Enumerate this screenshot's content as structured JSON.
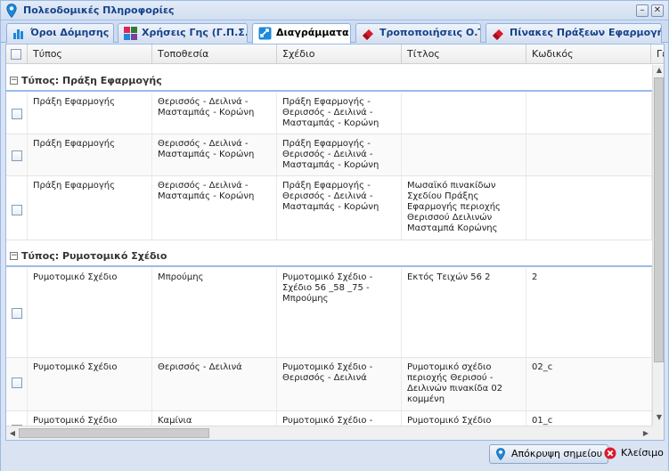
{
  "window": {
    "title": "Πολεοδομικές Πληροφορίες"
  },
  "tabs": [
    {
      "label": "Όροι Δόμησης",
      "icon": "bar-chart-icon"
    },
    {
      "label": "Χρήσεις Γης (Γ.Π.Σ.)",
      "icon": "color-squares-icon"
    },
    {
      "label": "Διαγράμματα",
      "icon": "diagram-icon",
      "active": true
    },
    {
      "label": "Τροποποιήσεις Ο.Τ.",
      "icon": "eraser-icon"
    },
    {
      "label": "Πίνακες Πράξεων Εφαρμογής",
      "icon": "eraser-icon"
    }
  ],
  "columns": [
    "Τύπος",
    "Τοποθεσία",
    "Σχέδιο",
    "Τίτλος",
    "Κωδικός",
    "Γε"
  ],
  "groups": [
    {
      "label": "Τύπος: Πράξη Εφαρμογής",
      "rows": [
        {
          "type": "Πράξη Εφαρμογής",
          "location": "Θερισσός - Δειλινά - Μασταμπάς - Κορώνη",
          "plan": "Πράξη Εφαρμογής - Θερισσός - Δειλινά - Μασταμπάς - Κορώνη",
          "title": "",
          "code": ""
        },
        {
          "type": "Πράξη Εφαρμογής",
          "location": "Θερισσός - Δειλινά - Μασταμπάς - Κορώνη",
          "plan": "Πράξη Εφαρμογής - Θερισσός - Δειλινά - Μασταμπάς - Κορώνη",
          "title": "",
          "code": ""
        },
        {
          "type": "Πράξη Εφαρμογής",
          "location": "Θερισσός - Δειλινά - Μασταμπάς - Κορώνη",
          "plan": "Πράξη Εφαρμογής - Θερισσός - Δειλινά - Μασταμπάς - Κορώνη",
          "title": "Μωσαϊκό πινακίδων Σχεδίου Πράξης Εφαρμογής περιοχής Θερισσού Δειλινών Μασταμπά Κορώνης",
          "code": ""
        }
      ]
    },
    {
      "label": "Τύπος: Ρυμοτομικό Σχέδιο",
      "rows": [
        {
          "type": "Ρυμοτομικό Σχέδιο",
          "location": "Μπρούμης",
          "plan": "Ρυμοτομικό Σχέδιο - Σχέδιο 56 _58 _75 - Μπρούμης",
          "title": "Εκτός Τειχών 56 2",
          "code": "2"
        },
        {
          "type": "Ρυμοτομικό Σχέδιο",
          "location": "Θερισσός - Δειλινά",
          "plan": "Ρυμοτομικό Σχέδιο - Θερισσός - Δειλινά",
          "title": "Ρυμοτομικό σχέδιο περιοχής Θερισού - Δειλινών πινακίδα 02 κομμένη",
          "code": "02_c"
        },
        {
          "type": "Ρυμοτομικό Σχέδιο",
          "location": "Καμίνια",
          "plan": "Ρυμοτομικό Σχέδιο -",
          "title": "Ρυμοτομικό Σχέδιο",
          "code": "01_c"
        }
      ]
    }
  ],
  "footer": {
    "hide_point_label": "Απόκρυψη σημείου",
    "close_label": "Κλείσιμο"
  },
  "colors": {
    "accent": "#15428b",
    "border": "#99bbe8"
  }
}
